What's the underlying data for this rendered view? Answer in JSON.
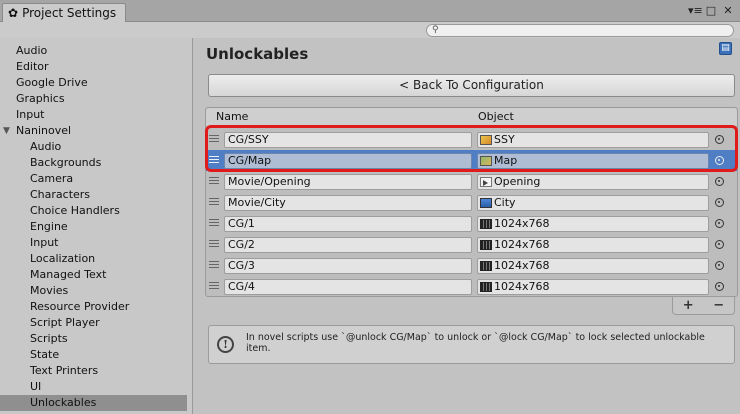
{
  "window": {
    "tab_title": "Project Settings",
    "search_placeholder": "",
    "controls": [
      "▾≡",
      "□",
      "✕"
    ]
  },
  "sidebar": {
    "items": [
      {
        "label": "Audio",
        "level": 0
      },
      {
        "label": "Editor",
        "level": 0
      },
      {
        "label": "Google Drive",
        "level": 0
      },
      {
        "label": "Graphics",
        "level": 0
      },
      {
        "label": "Input",
        "level": 0
      },
      {
        "label": "Naninovel",
        "level": 0,
        "expanded": true
      },
      {
        "label": "Audio",
        "level": 1
      },
      {
        "label": "Backgrounds",
        "level": 1
      },
      {
        "label": "Camera",
        "level": 1
      },
      {
        "label": "Characters",
        "level": 1
      },
      {
        "label": "Choice Handlers",
        "level": 1
      },
      {
        "label": "Engine",
        "level": 1
      },
      {
        "label": "Input",
        "level": 1
      },
      {
        "label": "Localization",
        "level": 1
      },
      {
        "label": "Managed Text",
        "level": 1
      },
      {
        "label": "Movies",
        "level": 1
      },
      {
        "label": "Resource Provider",
        "level": 1
      },
      {
        "label": "Script Player",
        "level": 1
      },
      {
        "label": "Scripts",
        "level": 1
      },
      {
        "label": "State",
        "level": 1
      },
      {
        "label": "Text Printers",
        "level": 1
      },
      {
        "label": "UI",
        "level": 1
      },
      {
        "label": "Unlockables",
        "level": 1,
        "selected": true
      }
    ]
  },
  "main": {
    "title": "Unlockables",
    "back_button": "< Back To Configuration",
    "columns": {
      "name": "Name",
      "object": "Object"
    },
    "rows": [
      {
        "name": "CG/SSY",
        "object": "SSY",
        "icon": "image-icon",
        "selected": false
      },
      {
        "name": "CG/Map",
        "object": "Map",
        "icon": "image-icon",
        "selected": true
      },
      {
        "name": "Movie/Opening",
        "object": "Opening",
        "icon": "video-icon",
        "selected": false
      },
      {
        "name": "Movie/City",
        "object": "City",
        "icon": "video-icon",
        "selected": false
      },
      {
        "name": "CG/1",
        "object": "1024x768",
        "icon": "film-icon",
        "selected": false
      },
      {
        "name": "CG/2",
        "object": "1024x768",
        "icon": "film-icon",
        "selected": false
      },
      {
        "name": "CG/3",
        "object": "1024x768",
        "icon": "film-icon",
        "selected": false
      },
      {
        "name": "CG/4",
        "object": "1024x768",
        "icon": "film-icon",
        "selected": false
      }
    ],
    "add_label": "+",
    "remove_label": "−",
    "help_text": "In novel scripts use `@unlock CG/Map` to unlock or `@lock CG/Map` to lock selected unlockable item."
  },
  "colors": {
    "selection": "#4f7ec4",
    "highlight": "#e01b1b"
  }
}
